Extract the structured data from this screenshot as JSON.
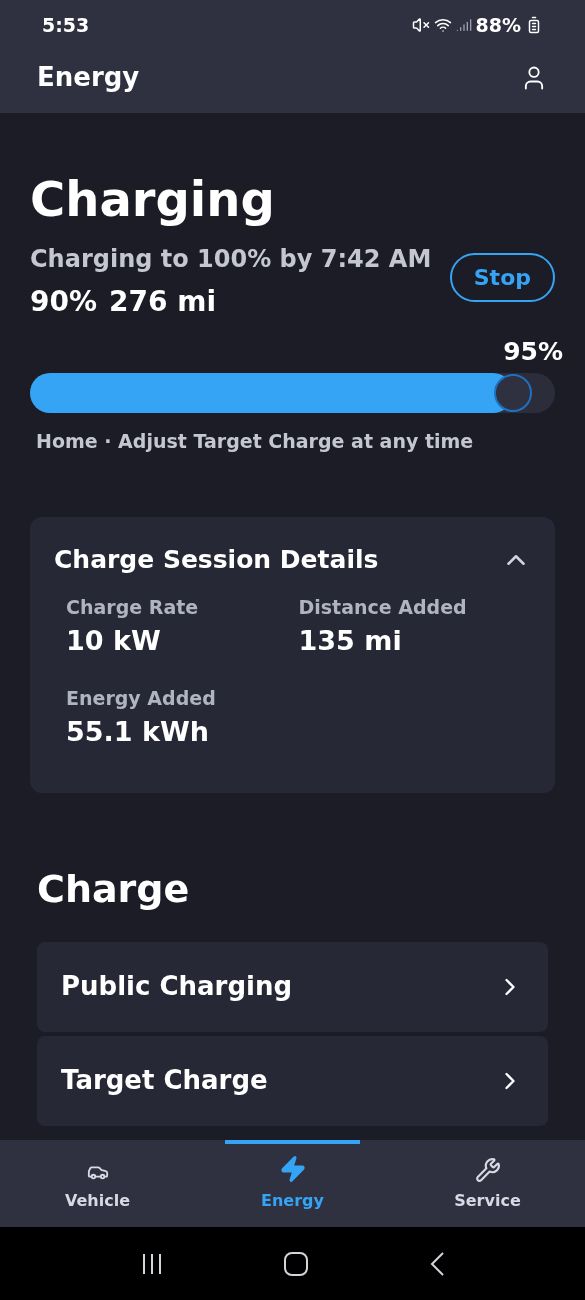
{
  "status_bar": {
    "time": "5:53",
    "battery": "88%"
  },
  "header": {
    "title": "Energy"
  },
  "charging": {
    "title": "Charging",
    "subtitle": "Charging to 100% by 7:42 AM",
    "percent": "90%",
    "range": "276 mi",
    "stop_button": "Stop",
    "target_label": "95%",
    "level": 0.92,
    "note": "Home · Adjust Target Charge at any time"
  },
  "session": {
    "title": "Charge Session Details",
    "expanded": true,
    "details": [
      {
        "label": "Charge Rate",
        "value": "10 kW"
      },
      {
        "label": "Distance Added",
        "value": "135 mi"
      },
      {
        "label": "Energy Added",
        "value": "55.1 kWh"
      }
    ]
  },
  "charge": {
    "title": "Charge",
    "items": [
      "Public Charging",
      "Target Charge"
    ]
  },
  "tabs": [
    {
      "label": "Vehicle",
      "kind": "car",
      "selected": false
    },
    {
      "label": "Energy",
      "kind": "bolt",
      "selected": true
    },
    {
      "label": "Service",
      "kind": "tools",
      "selected": false
    }
  ]
}
